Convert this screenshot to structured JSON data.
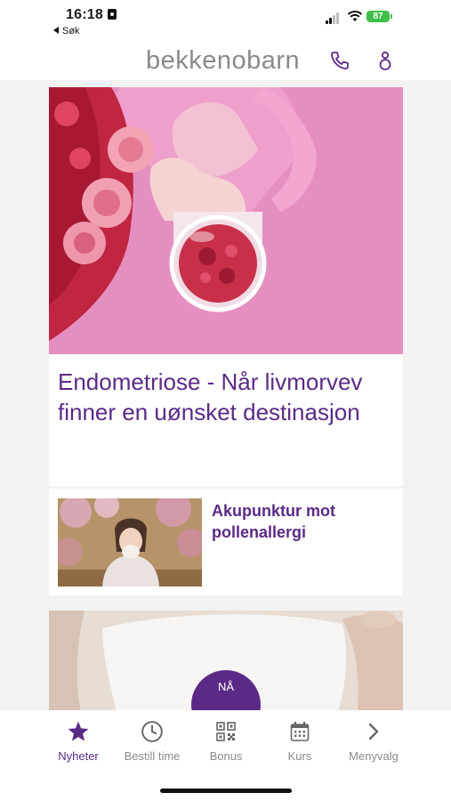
{
  "status_bar": {
    "time": "16:18",
    "back_label": "Søk",
    "battery": "87"
  },
  "header": {
    "logo_text": "bekkenobarn"
  },
  "feed": {
    "featured": {
      "title": "Endometriose - Når livmorvev finner en uønsket destinasjon"
    },
    "secondary": {
      "title": "Akupunktur mot pollenallergi"
    }
  },
  "floating_button": {
    "label": "NÅ"
  },
  "tabbar": {
    "tabs": [
      {
        "label": "Nyheter",
        "icon": "star-icon",
        "active": true
      },
      {
        "label": "Bestill time",
        "icon": "clock-icon",
        "active": false
      },
      {
        "label": "Bonus",
        "icon": "qr-code-icon",
        "active": false
      },
      {
        "label": "Kurs",
        "icon": "calendar-icon",
        "active": false
      },
      {
        "label": "Menyvalg",
        "icon": "chevron-right-icon",
        "active": false
      }
    ]
  },
  "colors": {
    "brand_purple": "#5b2a86",
    "logo_gray": "#8a8a8a",
    "battery_green": "#3fbf4a",
    "hero_pink": "#e893c2"
  }
}
